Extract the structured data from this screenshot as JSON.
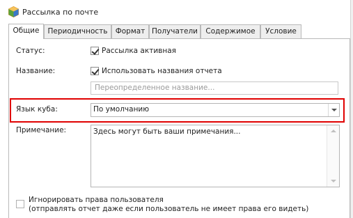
{
  "window": {
    "title": "Рассылка по почте"
  },
  "tabs": [
    {
      "label": "Общие",
      "active": true
    },
    {
      "label": "Периодичность"
    },
    {
      "label": "Формат"
    },
    {
      "label": "Получатели"
    },
    {
      "label": "Содержимое"
    },
    {
      "label": "Условие"
    }
  ],
  "general": {
    "status_label": "Статус:",
    "status_checkbox_label": "Рассылка активная",
    "status_checked": true,
    "name_label": "Название:",
    "name_checkbox_label": "Использовать названия отчета",
    "name_checked": true,
    "name_override_placeholder": "Переопределенное название...",
    "cube_language_label": "Язык куба:",
    "cube_language_value": "По умолчанию",
    "note_label": "Примечание:",
    "note_value": "Здесь могут быть ваши примечания...",
    "ignore_rights_label_line1": "Игнорировать права пользователя",
    "ignore_rights_label_line2": "(отправлять отчет даже если пользователь не имеет права его видеть)",
    "ignore_rights_checked": false
  },
  "colors": {
    "highlight": "#e00000",
    "border": "#b9b9b9",
    "placeholder": "#9a9a9a"
  }
}
